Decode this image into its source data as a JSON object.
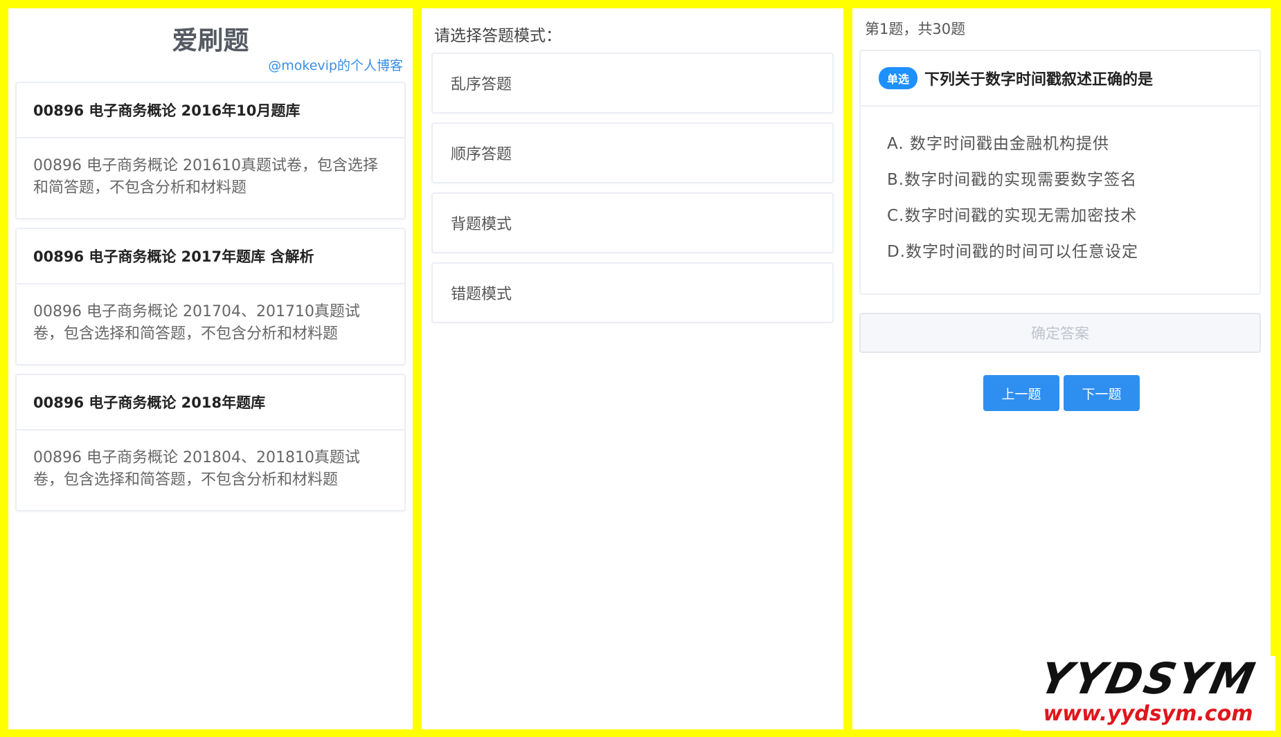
{
  "left": {
    "title": "爱刷题",
    "blog_link": "@mokevip的个人博客",
    "banks": [
      {
        "title": "00896 电子商务概论 2016年10月题库",
        "desc": "00896 电子商务概论 201610真题试卷，包含选择和简答题，不包含分析和材料题"
      },
      {
        "title": "00896 电子商务概论 2017年题库 含解析",
        "desc": "00896 电子商务概论 201704、201710真题试卷，包含选择和简答题，不包含分析和材料题"
      },
      {
        "title": "00896 电子商务概论 2018年题库",
        "desc": "00896 电子商务概论 201804、201810真题试卷，包含选择和简答题，不包含分析和材料题"
      }
    ]
  },
  "mid": {
    "prompt": "请选择答题模式：",
    "modes": [
      "乱序答题",
      "顺序答题",
      "背题模式",
      "错题模式"
    ]
  },
  "right": {
    "progress": "第1题，共30题",
    "question": {
      "type_badge": "单选",
      "text": "下列关于数字时间戳叙述正确的是",
      "options": [
        "A. 数字时间戳由金融机构提供",
        "B.数字时间戳的实现需要数字签名",
        "C.数字时间戳的实现无需加密技术",
        "D.数字时间戳的时间可以任意设定"
      ]
    },
    "confirm_label": "确定答案",
    "prev_label": "上一题",
    "next_label": "下一题"
  },
  "watermark": {
    "brand": "YYDSYM",
    "url": "www.yydsym.com"
  },
  "colors": {
    "frame": "#ffff00",
    "accent": "#2f8ff0",
    "link": "#3a8ee6",
    "watermark_url": "#e0161d"
  }
}
